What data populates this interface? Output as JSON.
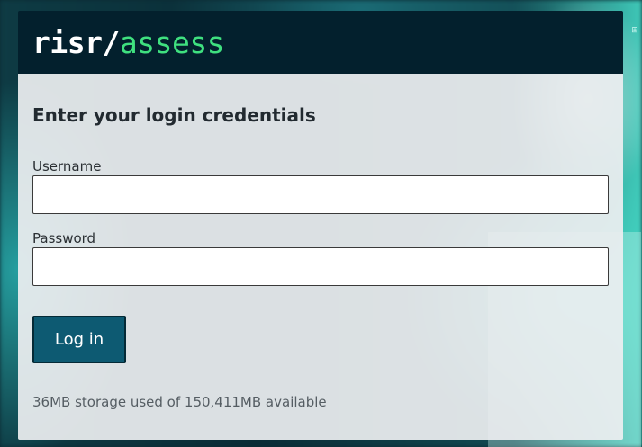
{
  "brand": {
    "logo_part_a": "risr/",
    "logo_part_b": "assess"
  },
  "login": {
    "heading": "Enter your login credentials",
    "username_label": "Username",
    "username_value": "",
    "password_label": "Password",
    "password_value": "",
    "login_button_label": "Log in"
  },
  "storage_status": "36MB storage used of 150,411MB available",
  "colors": {
    "header_bg": "#03202d",
    "logo_accent": "#3fe07f",
    "button_bg": "#0d5a72"
  }
}
